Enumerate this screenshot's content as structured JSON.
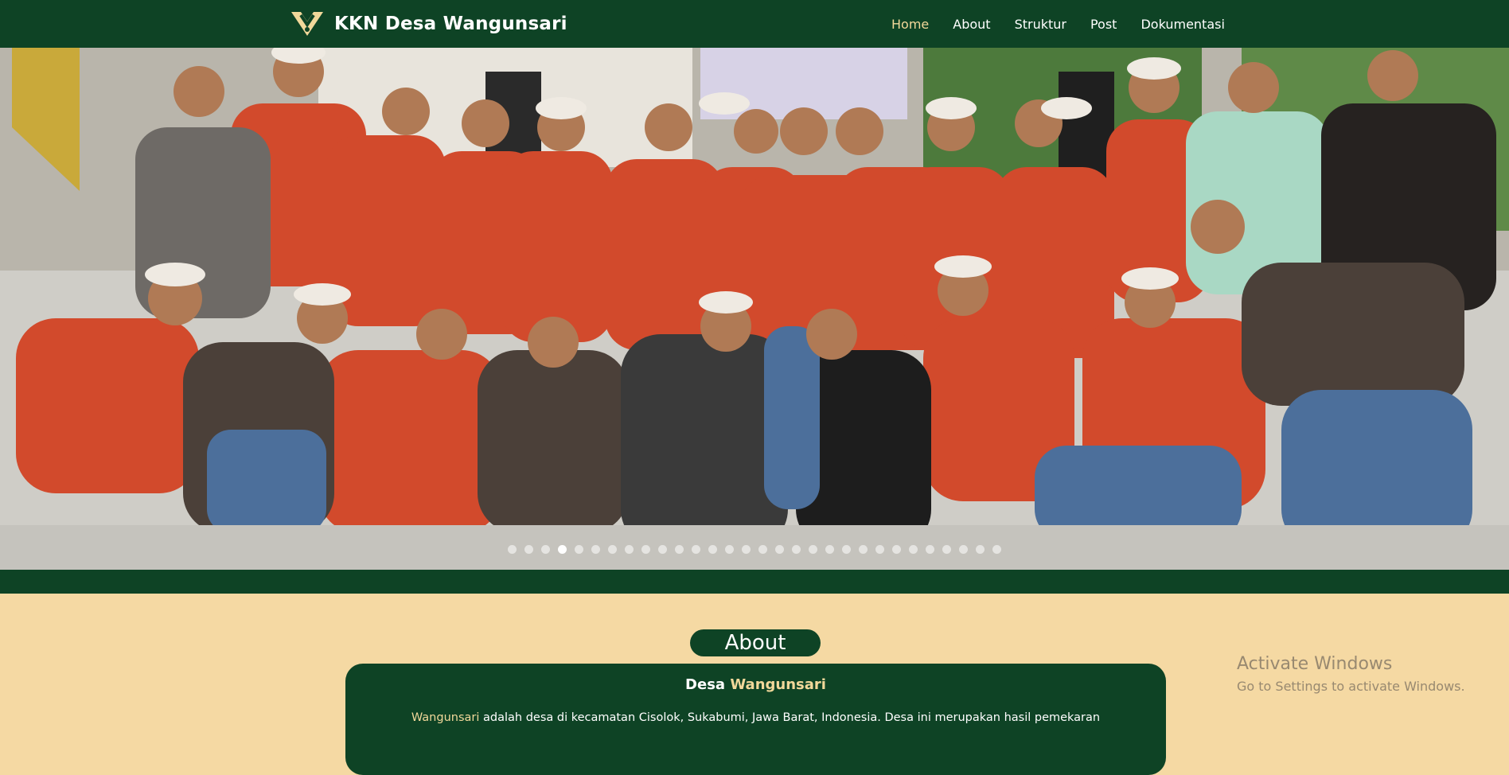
{
  "navbar": {
    "brand": "KKN Desa Wangunsari",
    "links": [
      "Home",
      "About",
      "Struktur",
      "Post",
      "Dokumentasi"
    ],
    "active": "Home"
  },
  "hero": {
    "slide_count": 30,
    "active_index": 3
  },
  "about": {
    "title": "About",
    "heading_prefix": "Desa",
    "heading_accent": "Wangunsari",
    "text_accent": "Wangunsari",
    "text": "adalah desa di kecamatan Cisolok, Sukabumi, Jawa Barat, Indonesia. Desa ini merupakan hasil pemekaran"
  },
  "watermark": {
    "title": "Activate Windows",
    "subtitle": "Go to Settings to activate Windows."
  },
  "colors": {
    "primary": "#0e4325",
    "background": "#f5d9a3",
    "accent": "#f1d89a"
  }
}
